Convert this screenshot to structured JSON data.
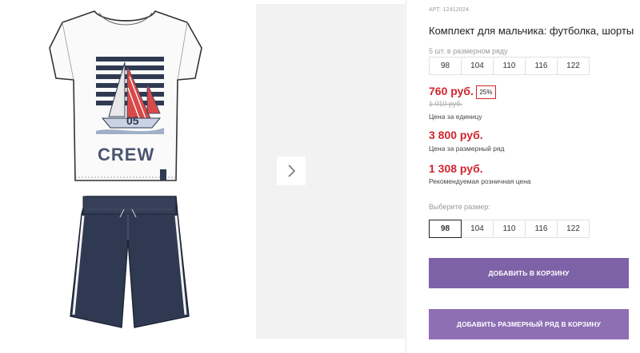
{
  "product": {
    "art": "АРТ. 12412024",
    "title": "Комплект для мальчика: футболка, шорты",
    "pack_note": "5 шт. в размерном ряду",
    "pack_sizes": [
      "98",
      "104",
      "110",
      "116",
      "122"
    ],
    "price": "760 руб.",
    "discount": "25%",
    "old_price": "1 010 руб.",
    "unit_caption": "Цена за единицу",
    "row_price": "3 800 руб.",
    "row_caption": "Цена за размерный ряд",
    "retail_price": "1 308 руб.",
    "retail_caption": "Рекомендуемая розничная цена",
    "choose_label": "Выберите размер:",
    "sizes": [
      "98",
      "104",
      "110",
      "116",
      "122"
    ],
    "selected_size": "98"
  },
  "image": {
    "shirt_print_text": "CREW",
    "shirt_print_number": "05"
  },
  "buttons": {
    "add_to_cart": "ДОБАВИТЬ В КОРЗИНУ",
    "add_row_to_cart": "ДОБАВИТЬ РАЗМЕРНЫЙ РЯД В КОРЗИНУ"
  },
  "icons": {
    "next": "chevron-right-icon"
  },
  "colors": {
    "price_red": "#d0252f",
    "button_primary": "#7e62a8",
    "button_secondary": "#8e6fb4",
    "shorts_navy": "#2f3a52"
  }
}
